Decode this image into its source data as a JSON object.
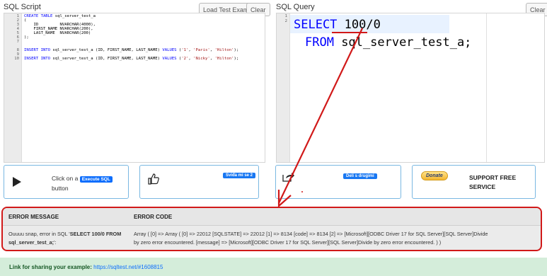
{
  "script_panel": {
    "title": "SQL Script",
    "load_button": "Load Test Example",
    "clear_button": "Clear",
    "line_numbers": [
      "1",
      "2",
      "3",
      "4",
      "5",
      "6",
      "7",
      "8",
      "9",
      "10"
    ],
    "lines": {
      "l1_kw": "CREATE TABLE",
      "l1_rest": " sql_server_test_a",
      "l2": "(",
      "l3": "    ID         NVARCHAR(4000),",
      "l4": "    FIRST_NAME NVARCHAR(200),",
      "l5": "    LAST_NAME  NVARCHAR(200)",
      "l6": ");",
      "l8_kw": "INSERT INTO",
      "l8_mid": " sql_server_test_a (ID, FIRST_NAME, LAST_NAME) ",
      "l8_kw2": "VALUES",
      "l8_open": " (",
      "l8_s1": "'1'",
      "l8_c1": ", ",
      "l8_s2": "'Paris'",
      "l8_c2": ", ",
      "l8_s3": "'Hilton'",
      "l8_close": ");",
      "l10_kw": "INSERT INTO",
      "l10_mid": " sql_server_test_a (ID, FIRST_NAME, LAST_NAME) ",
      "l10_kw2": "VALUES",
      "l10_open": " (",
      "l10_s1": "'2'",
      "l10_c1": ", ",
      "l10_s2": "'Nicky'",
      "l10_c2": ", ",
      "l10_s3": "'Hilton'",
      "l10_close": ");"
    }
  },
  "query_panel": {
    "title": "SQL Query",
    "clear_button": "Clear",
    "line_numbers": [
      "1",
      "2"
    ],
    "line1_kw": "SELECT",
    "line1_val": " 100/0",
    "line2_kw": "FROM",
    "line2_rest": " sql_server_test_a;"
  },
  "cards": {
    "run_text_before": "Click on a",
    "run_badge": "Execute SQL",
    "run_text_after": "button",
    "like_badge": "Sviđa mi se 2",
    "share_badge": "Deli s drugimi",
    "donate_label": "Donate",
    "support_text": "SUPPORT FREE SERVICE"
  },
  "error": {
    "col1_header": "ERROR MESSAGE",
    "col2_header": "ERROR CODE",
    "message_prefix": "Ouuuu snap, error in SQL '",
    "message_sql": "SELECT 100/0 FROM sql_server_test_a;",
    "message_suffix": "':",
    "code_line1": "Array ( [0] => Array ( [0] => 22012 [SQLSTATE] => 22012 [1] => 8134 [code] => 8134 [2] => [Microsoft][ODBC Driver 17 for SQL Server][SQL Server]Divide",
    "code_line2": "by zero error encountered. [message] => [Microsoft][ODBC Driver 17 for SQL Server][SQL Server]Divide by zero error encountered. ) )"
  },
  "share": {
    "label": "Link for sharing your example:",
    "url": "https://sqltest.net/#1608815"
  },
  "colors": {
    "accent_blue": "#0d6efd",
    "error_red": "#d11919",
    "success_green": "#d4edda"
  }
}
